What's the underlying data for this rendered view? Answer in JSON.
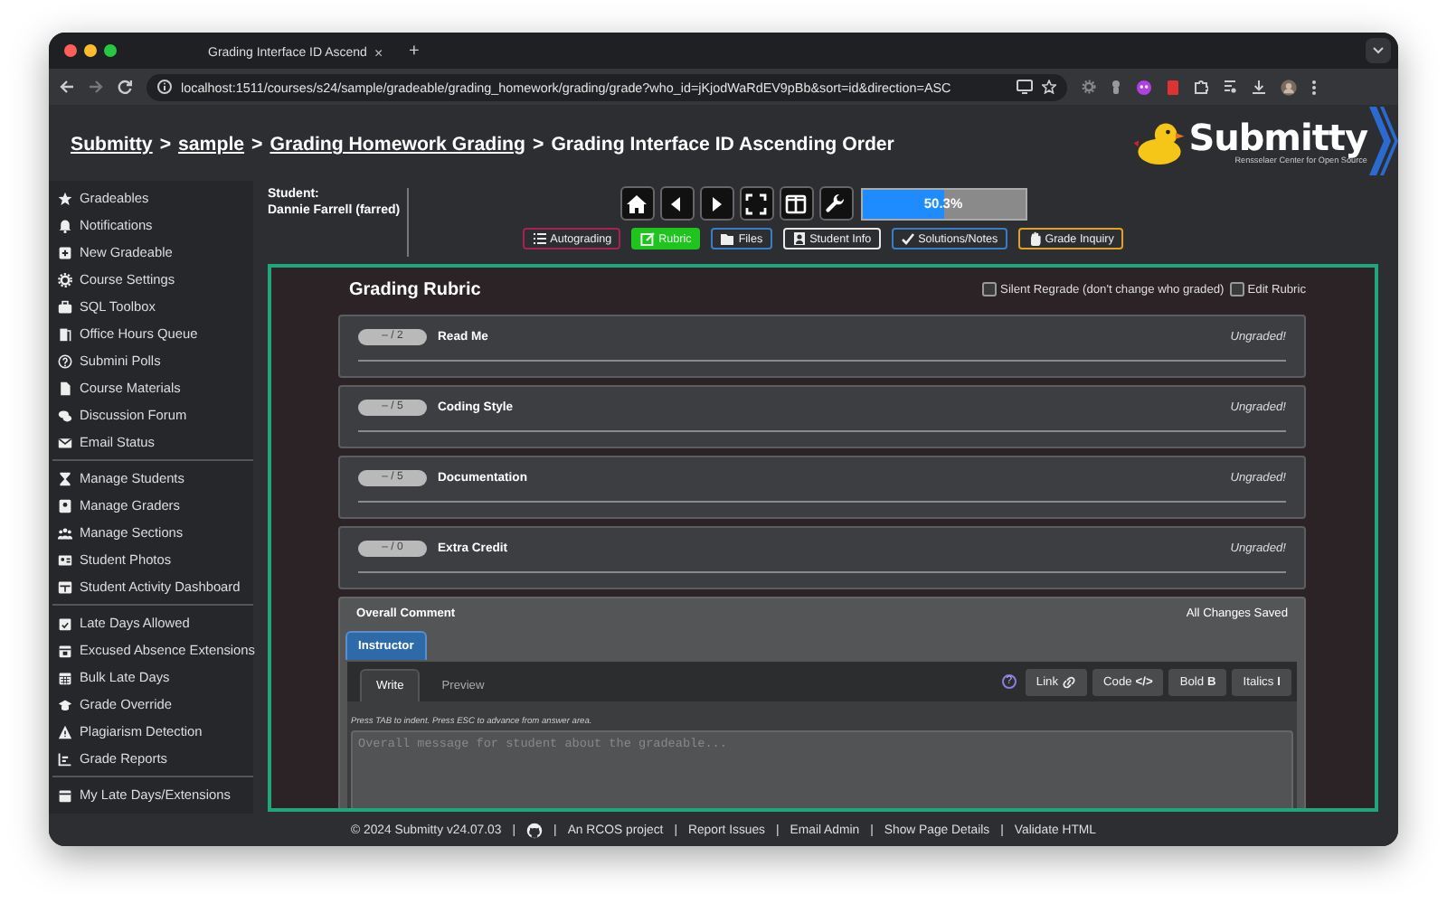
{
  "browser": {
    "tab_title": "Grading Interface ID Ascend",
    "tab_close": "×",
    "new_tab": "+",
    "url": "localhost:1511/courses/s24/sample/gradeable/grading_homework/grading/grade?who_id=jKjodWaRdEV9pBb&sort=id&direction=ASC"
  },
  "breadcrumbs": {
    "separator": ">",
    "items": [
      {
        "label": "Submitty",
        "link": true
      },
      {
        "label": "sample",
        "link": true
      },
      {
        "label": "Grading Homework Grading",
        "link": true
      },
      {
        "label": "Grading Interface ID Ascending Order",
        "link": false
      }
    ]
  },
  "logo": {
    "name": "Submitty",
    "tagline": "Rensselaer Center for Open Source"
  },
  "sidebar": {
    "groups": [
      {
        "items": [
          {
            "label": "Gradeables"
          },
          {
            "label": "Notifications"
          },
          {
            "label": "New Gradeable"
          },
          {
            "label": "Course Settings"
          },
          {
            "label": "SQL Toolbox"
          },
          {
            "label": "Office Hours Queue"
          },
          {
            "label": "Submini Polls"
          },
          {
            "label": "Course Materials"
          },
          {
            "label": "Discussion Forum"
          },
          {
            "label": "Email Status"
          }
        ]
      },
      {
        "items": [
          {
            "label": "Manage Students"
          },
          {
            "label": "Manage Graders"
          },
          {
            "label": "Manage Sections"
          },
          {
            "label": "Student Photos"
          },
          {
            "label": "Student Activity Dashboard"
          }
        ]
      },
      {
        "items": [
          {
            "label": "Late Days Allowed"
          },
          {
            "label": "Excused Absence Extensions"
          },
          {
            "label": "Bulk Late Days"
          },
          {
            "label": "Grade Override"
          },
          {
            "label": "Plagiarism Detection"
          },
          {
            "label": "Grade Reports"
          }
        ]
      },
      {
        "items": [
          {
            "label": "My Late Days/Extensions"
          }
        ]
      }
    ]
  },
  "student": {
    "label": "Student:",
    "name": "Dannie Farrell (farred)"
  },
  "progress": {
    "level": 0.503,
    "reading": "50.3%"
  },
  "panel_buttons": [
    {
      "label": "Autograding",
      "color": "#a3244c",
      "selected": false
    },
    {
      "label": "Rubric",
      "color": "#1fc41f",
      "selected": true
    },
    {
      "label": "Files",
      "color": "#3a7dc4",
      "selected": false
    },
    {
      "label": "Student Info",
      "color": "#e8e8e8",
      "selected": false
    },
    {
      "label": "Solutions/Notes",
      "color": "#3a7dc4",
      "selected": false
    },
    {
      "label": "Grade Inquiry",
      "color": "#e0a02a",
      "selected": false
    }
  ],
  "rubric": {
    "title": "Grading Rubric",
    "options": [
      {
        "label": "Silent Regrade (don't change who graded)",
        "checked": false
      },
      {
        "label": "Edit Rubric",
        "checked": false
      }
    ],
    "components": [
      {
        "score": "– / 2",
        "title": "Read Me",
        "status": "Ungraded!"
      },
      {
        "score": "– / 5",
        "title": "Coding Style",
        "status": "Ungraded!"
      },
      {
        "score": "– / 5",
        "title": "Documentation",
        "status": "Ungraded!"
      },
      {
        "score": "– / 0",
        "title": "Extra Credit",
        "status": "Ungraded!"
      }
    ]
  },
  "overall_comment": {
    "title": "Overall Comment",
    "status": "All Changes Saved",
    "tabs": [
      {
        "label": "Instructor",
        "selected": true
      }
    ],
    "editor_tabs": [
      {
        "label": "Write",
        "selected": true
      },
      {
        "label": "Preview",
        "selected": false
      }
    ],
    "help_glyph": "?",
    "format_buttons": [
      {
        "label": "Link"
      },
      {
        "label": "Code",
        "glyph": "</>"
      },
      {
        "label": "Bold",
        "glyph": "B"
      },
      {
        "label": "Italics",
        "glyph": "I"
      }
    ],
    "hint": "Press TAB to indent. Press ESC to advance from answer area.",
    "placeholder": "Overall message for student about the gradeable..."
  },
  "footer": {
    "separator": "|",
    "items": [
      {
        "kind": "text",
        "label": "© 2024 Submitty v24.07.03"
      },
      {
        "kind": "icon"
      },
      {
        "kind": "link",
        "label": "An RCOS project"
      },
      {
        "kind": "link",
        "label": "Report Issues"
      },
      {
        "kind": "link",
        "label": "Email Admin"
      },
      {
        "kind": "link",
        "label": "Show Page Details"
      },
      {
        "kind": "link",
        "label": "Validate HTML"
      }
    ]
  }
}
